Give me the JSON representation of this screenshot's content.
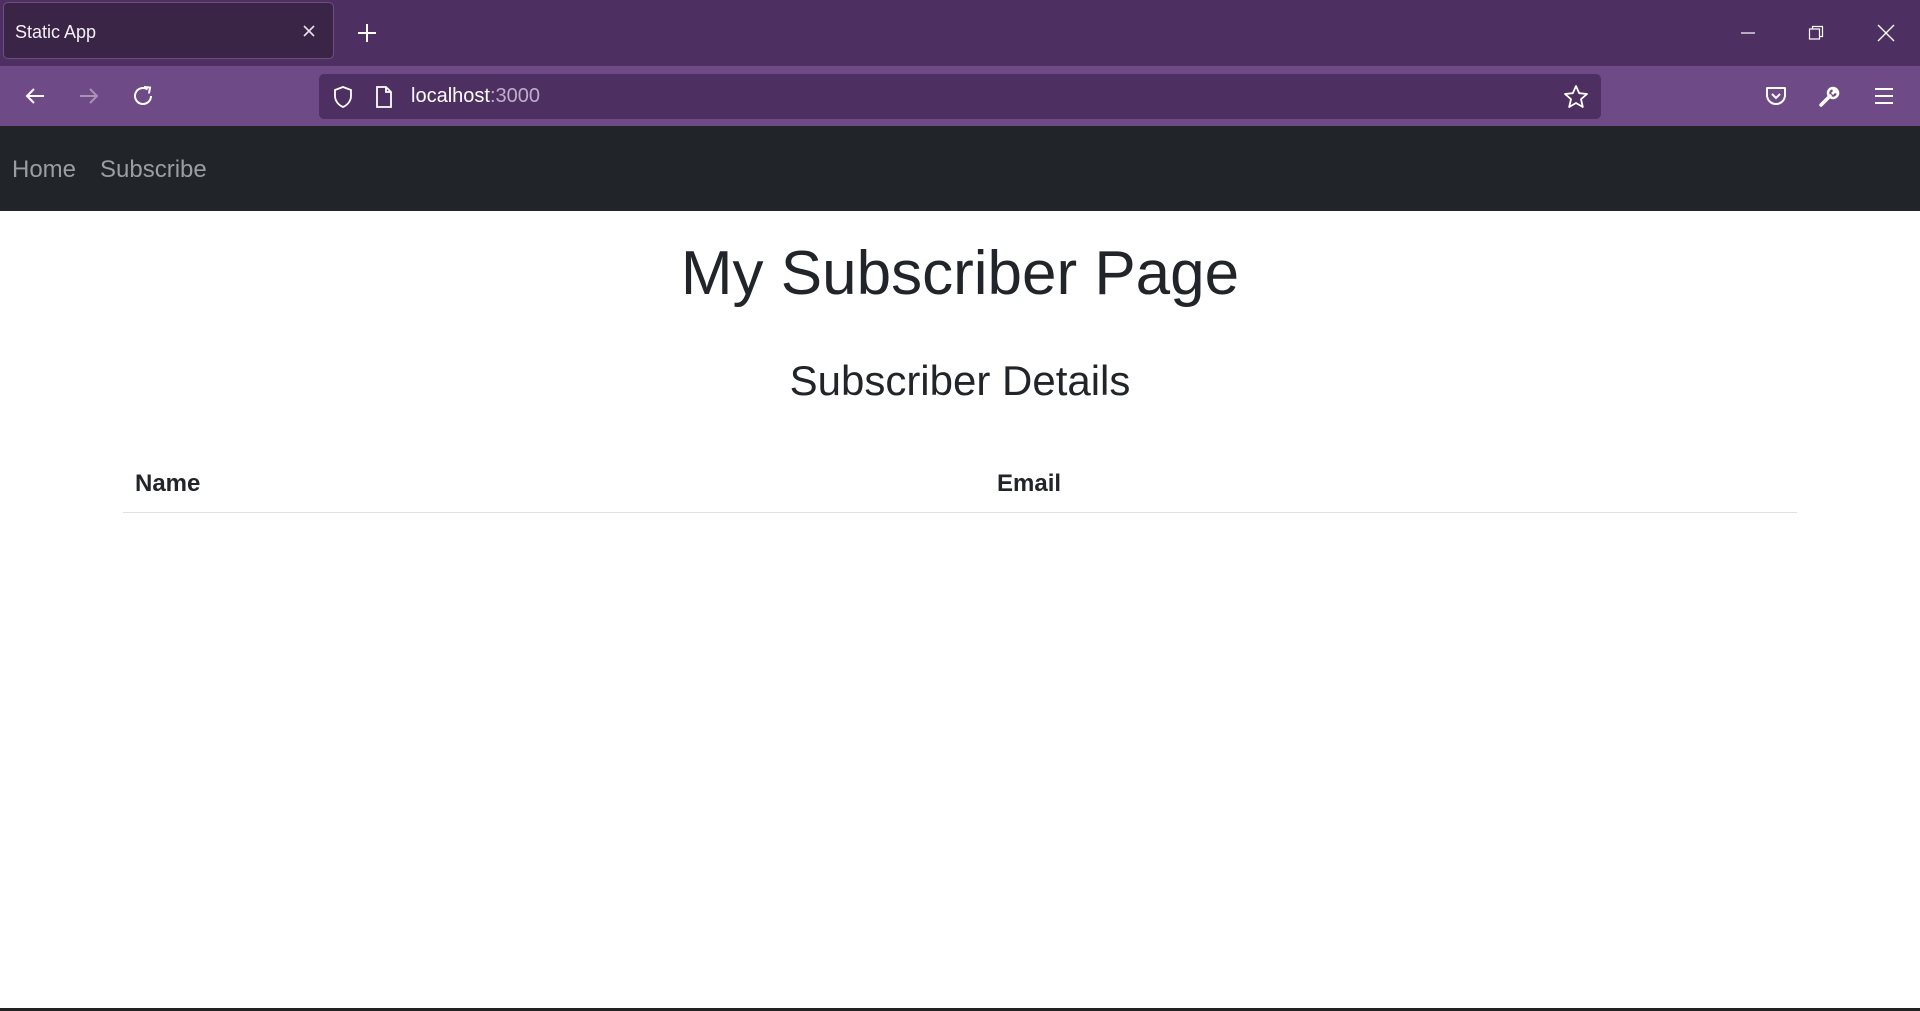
{
  "browser": {
    "tab_title": "Static App",
    "url_host": "localhost",
    "url_port": ":3000",
    "icons": [
      "close-icon",
      "plus-icon",
      "minimize-icon",
      "restore-icon",
      "window-close-icon",
      "back-arrow-icon",
      "forward-arrow-icon",
      "reload-icon",
      "shield-icon",
      "page-icon",
      "star-icon",
      "pocket-icon",
      "wrench-icon",
      "hamburger-menu-icon"
    ]
  },
  "site_nav": {
    "items": [
      {
        "label": "Home"
      },
      {
        "label": "Subscribe"
      }
    ]
  },
  "main": {
    "title": "My Subscriber Page",
    "section_title": "Subscriber Details",
    "table": {
      "columns": [
        "Name",
        "Email"
      ],
      "rows": []
    }
  },
  "colors": {
    "titlebar": "#4e2f62",
    "toolbar": "#6e4b87",
    "site_nav": "#212529",
    "nav_link": "#9a9da1",
    "text": "#212529"
  }
}
